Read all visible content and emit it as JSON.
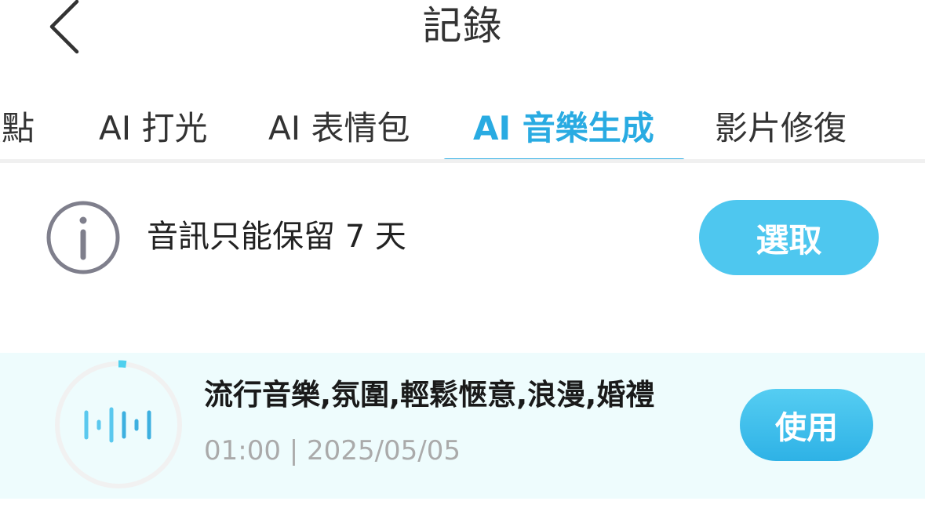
{
  "header": {
    "title": "記錄",
    "back_icon": "chevron-left-icon"
  },
  "tabs": [
    {
      "label": "焦點"
    },
    {
      "label": "AI 打光"
    },
    {
      "label": "AI 表情包"
    },
    {
      "label": "AI 音樂生成",
      "active": true
    },
    {
      "label": "影片修復"
    }
  ],
  "info": {
    "icon": "info-icon",
    "text": "音訊只能保留 7 天",
    "select_label": "選取"
  },
  "records": [
    {
      "title": "流行音樂,氛圍,輕鬆愜意,浪漫,婚禮",
      "meta": "01:00 | 2025/05/05",
      "progress": 0.02,
      "icon": "audio-waveform-icon",
      "use_label": "使用"
    }
  ],
  "colors": {
    "accent": "#29abe2",
    "button": "#4ec7ef",
    "record_bg": "#eefcfd",
    "text": "#333333",
    "meta": "#aaaaaa"
  }
}
